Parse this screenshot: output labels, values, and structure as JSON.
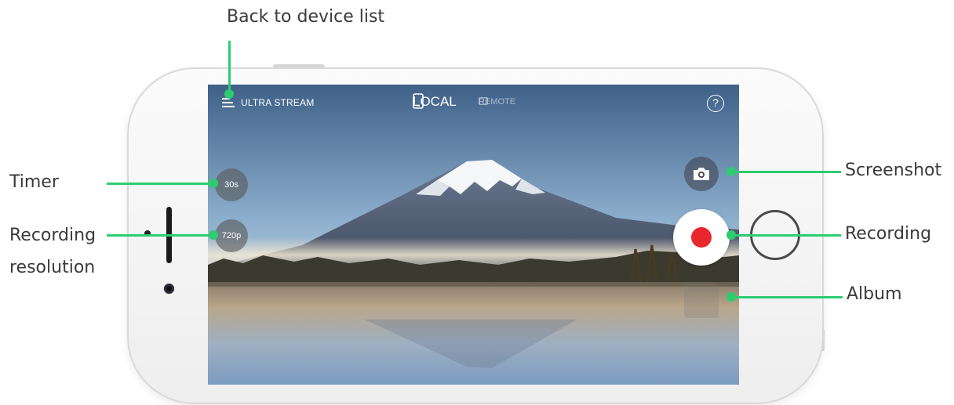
{
  "annotations": {
    "back": "Back to device list",
    "timer": "Timer",
    "resolution_line1": "Recording",
    "resolution_line2": "resolution",
    "screenshot": "Screenshot",
    "recording": "Recording",
    "album": "Album"
  },
  "app": {
    "brand": "ULTRA STREAM",
    "mode_local": "LOCAL",
    "mode_remote": "REMOTE",
    "help_symbol": "?",
    "timer_value": "30s",
    "resolution_value": "720p"
  },
  "icons": {
    "menu": "menu-icon",
    "phone": "phone-icon",
    "tablet": "tablet-icon",
    "help": "help-icon",
    "camera": "camera-icon",
    "record": "record-icon"
  },
  "colors": {
    "annotation_line": "#2ecc71",
    "record_dot": "#e8262b",
    "annotation_text": "#3a3a3a"
  }
}
